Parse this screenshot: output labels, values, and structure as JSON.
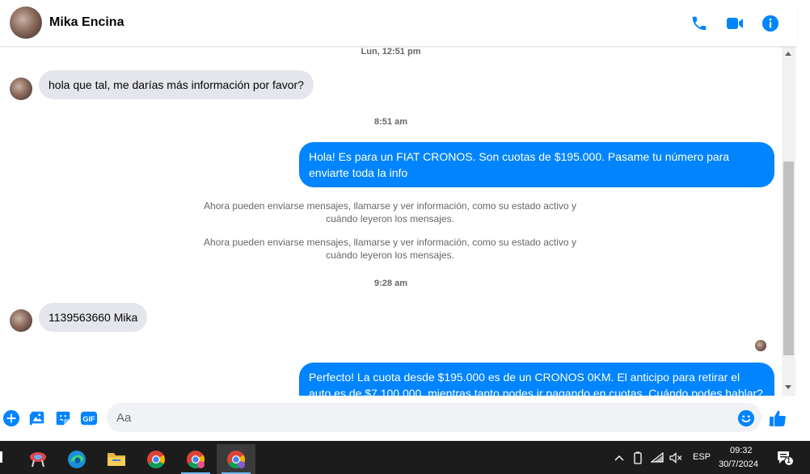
{
  "header": {
    "contact_name": "Mika Encina",
    "icons": [
      "phone-icon",
      "video-icon",
      "info-icon"
    ]
  },
  "conversation": {
    "time_1": "Lun, 12:51 pm",
    "msg_in_1": "hola que tal, me darías más información por favor?",
    "time_2": "8:51 am",
    "msg_out_1": "Hola! Es para un FIAT CRONOS. Son cuotas de $195.000. Pasame tu número para enviarte toda la info",
    "system_1": "Ahora pueden enviarse mensajes, llamarse y ver información, como su estado activo y cuándo leyeron los mensajes.",
    "system_2": "Ahora pueden enviarse mensajes, llamarse y ver información, como su estado activo y cuándo leyeron los mensajes.",
    "time_3": "9:28 am",
    "msg_in_2": "1139563660 Mika",
    "msg_out_2": "Perfecto! La cuota desde $195.000 es de un CRONOS 0KM. El anticipo para retirar el auto es de $7.100.000, mientras tanto podes ir pagando en cuotas. Cuándo podes hablar? A la"
  },
  "composer": {
    "placeholder": "Aa",
    "icons": [
      "plus-icon",
      "image-icon",
      "sticker-icon",
      "gif-icon",
      "emoji-icon",
      "like-icon"
    ],
    "gif_label": "GIF"
  },
  "colors": {
    "accent": "#0084ff",
    "incoming_bubble": "#e4e6eb",
    "taskbar": "#1c1c1c"
  },
  "taskbar": {
    "apps": [
      "pinwheel-app-icon",
      "edge-icon",
      "file-explorer-icon",
      "chrome-icon",
      "chrome-profile-icon",
      "chrome-profile-active-icon"
    ],
    "language": "ESP",
    "time": "09:32",
    "date": "30/7/2024",
    "notification_count": "1"
  }
}
